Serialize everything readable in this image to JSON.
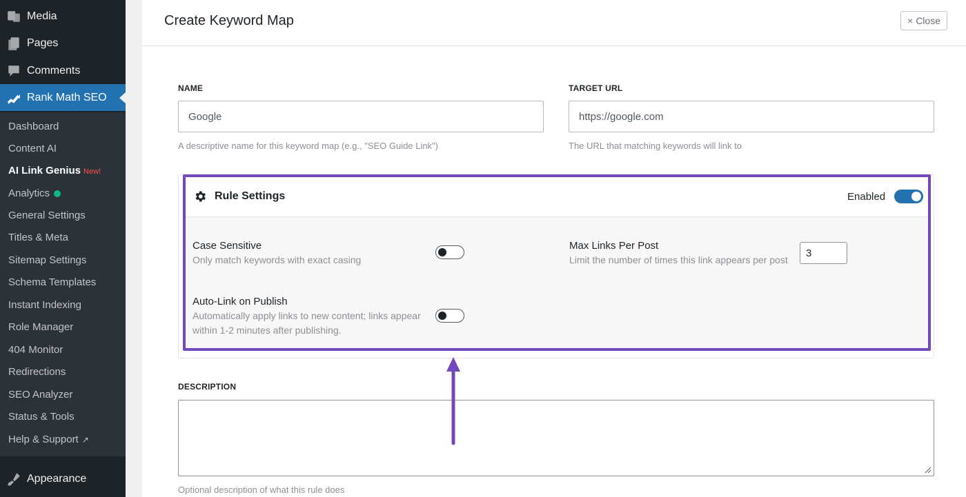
{
  "sidebar": {
    "top_items": [
      {
        "label": "Media",
        "icon": "media-icon"
      },
      {
        "label": "Pages",
        "icon": "pages-icon"
      },
      {
        "label": "Comments",
        "icon": "comments-icon"
      },
      {
        "label": "Rank Math SEO",
        "icon": "rank-math-icon"
      }
    ],
    "sub_items": [
      {
        "label": "Dashboard"
      },
      {
        "label": "Content AI"
      },
      {
        "label": "AI Link Genius",
        "badge": "New!"
      },
      {
        "label": "Analytics",
        "status_color": "#10b981"
      },
      {
        "label": "General Settings"
      },
      {
        "label": "Titles & Meta"
      },
      {
        "label": "Sitemap Settings"
      },
      {
        "label": "Schema Templates"
      },
      {
        "label": "Instant Indexing"
      },
      {
        "label": "Role Manager"
      },
      {
        "label": "404 Monitor"
      },
      {
        "label": "Redirections"
      },
      {
        "label": "SEO Analyzer"
      },
      {
        "label": "Status & Tools"
      },
      {
        "label": "Help & Support",
        "icon": "external-link-icon"
      }
    ],
    "bottom_item": {
      "label": "Appearance",
      "icon": "appearance-icon"
    }
  },
  "dialog": {
    "title": "Create Keyword Map",
    "close_label": "Close",
    "name": {
      "label": "NAME",
      "value": "Google",
      "help": "A descriptive name for this keyword map (e.g., \"SEO Guide Link\")"
    },
    "target_url": {
      "label": "TARGET URL",
      "value": "https://google.com",
      "help": "The URL that matching keywords will link to"
    },
    "rule_settings": {
      "title": "Rule Settings",
      "enabled_label": "Enabled",
      "enabled": true,
      "case_sensitive": {
        "title": "Case Sensitive",
        "desc": "Only match keywords with exact casing",
        "on": false
      },
      "auto_link": {
        "title": "Auto-Link on Publish",
        "desc_line1": "Automatically apply links to new content; links appear",
        "desc_line2": "within 1-2 minutes after publishing.",
        "on": false
      },
      "max_links": {
        "title": "Max Links Per Post",
        "desc": "Limit the number of times this link appears per post",
        "value": "3"
      }
    },
    "description": {
      "label": "DESCRIPTION",
      "value": "",
      "help": "Optional description of what this rule does"
    }
  },
  "colors": {
    "accent": "#2271b1",
    "highlight": "#7348bf",
    "sidebar_bg": "#1d2327"
  }
}
